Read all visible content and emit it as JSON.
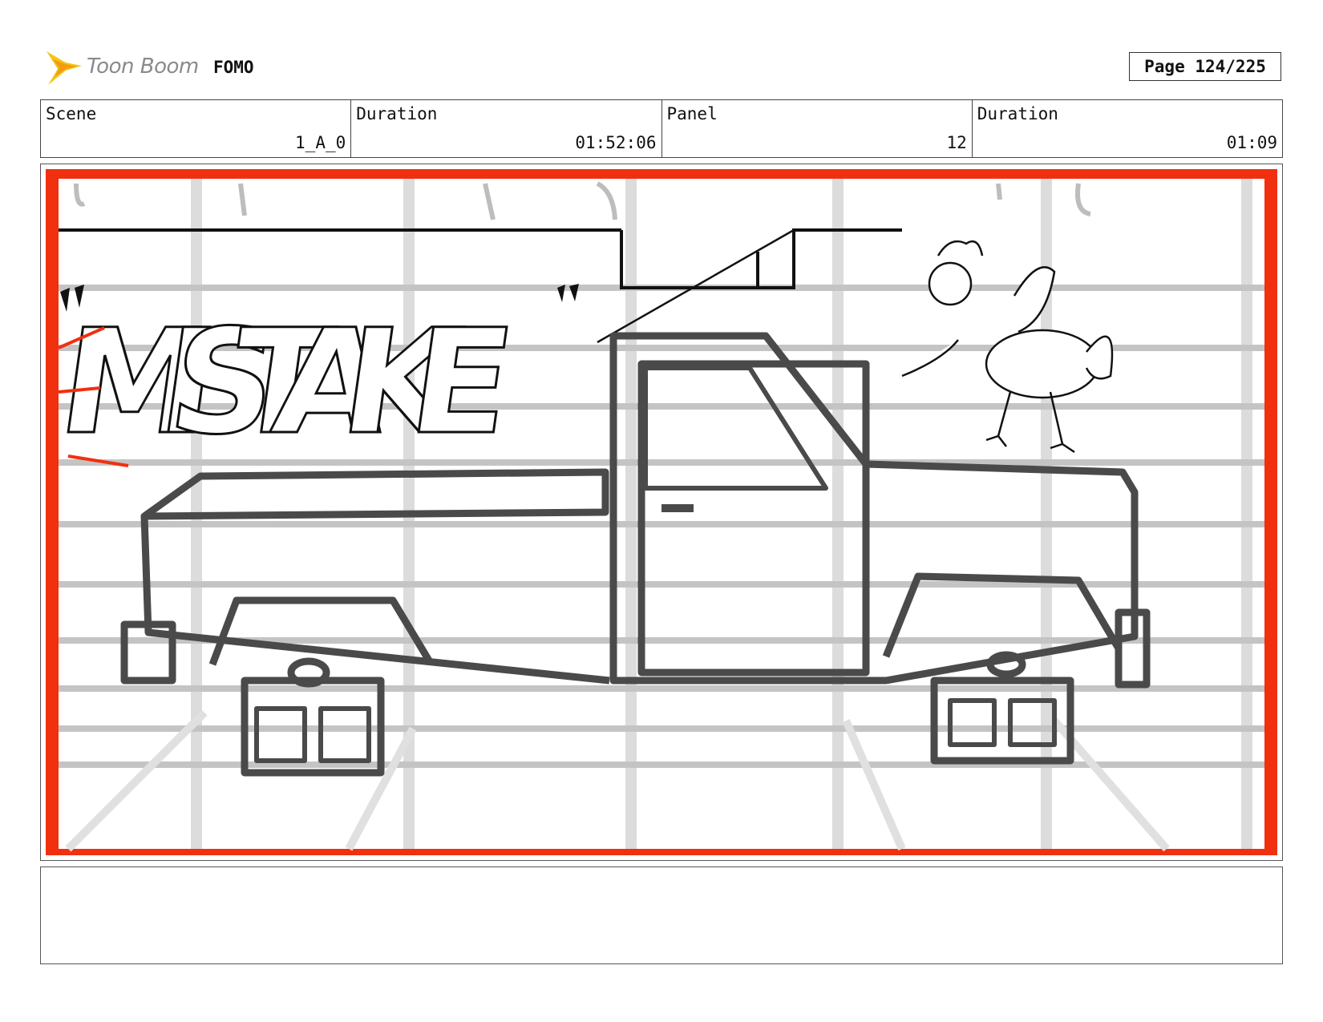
{
  "header": {
    "logo_text": "Toon Boom",
    "project_title": "FOMO",
    "page_label": "Page 124/225"
  },
  "info": {
    "scene_label": "Scene",
    "scene_value": "1_A_0",
    "scene_duration_label": "Duration",
    "scene_duration_value": "01:52:06",
    "panel_label": "Panel",
    "panel_value": "12",
    "panel_duration_label": "Duration",
    "panel_duration_value": "01:09"
  },
  "panel": {
    "graffiti_text": "MISTAKE",
    "frame_color": "#f0300f"
  },
  "notes": {
    "text": ""
  }
}
